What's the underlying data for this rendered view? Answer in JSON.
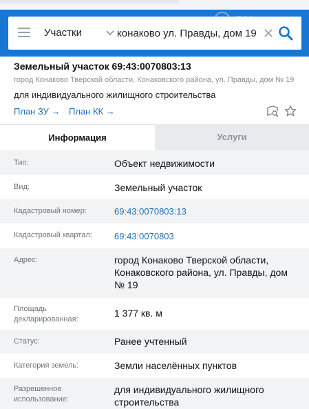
{
  "search": {
    "type_label": "Участки",
    "query": "конаково ул. Правды, дом 19"
  },
  "watermark": {
    "text": "ON"
  },
  "object": {
    "title": "Земельный участок 69:43:0070803:13",
    "address_gray": "город Конаково Тверской области, Конаковского района, ул. Правды, дом № 19",
    "purpose": "для индивидуального жилищного строительства",
    "link_zu": "План ЗУ →",
    "link_kk": "План КК →"
  },
  "tabs": {
    "info": "Информация",
    "services": "Услуги"
  },
  "rows": [
    {
      "label": "Тип:",
      "value": "Объект недвижимости"
    },
    {
      "label": "Вид:",
      "value": "Земельный участок"
    },
    {
      "label": "Кадастровый номер:",
      "value": "69:43:0070803:13"
    },
    {
      "label": "Кадастровый квартал:",
      "value": "69:43:0070803"
    },
    {
      "label": "Адрес:",
      "value": "город Конаково Тверской области, Конаковского района, ул. Правды, дом № 19"
    },
    {
      "label": "Площадь декларированная:",
      "value": "1 377 кв. м"
    },
    {
      "label": "Статус:",
      "value": "Ранее учтенный"
    },
    {
      "label": "Категория земель:",
      "value": "Земли населённых пунктов"
    },
    {
      "label": "Разрешенное использование:",
      "value": "для индивидуального жилищного строительства"
    }
  ],
  "icons": {
    "menu": "hamburger-menu-icon",
    "dropdown": "chevron-down-icon",
    "clear": "close-icon",
    "search": "search-icon",
    "map_search": "map-search-icon",
    "favorite": "star-icon"
  },
  "colors": {
    "header_blue": "#1976d2",
    "link_blue": "#1e6fb8",
    "row_shade": "#f2f3f5",
    "inactive_tab": "#e8ebee"
  }
}
